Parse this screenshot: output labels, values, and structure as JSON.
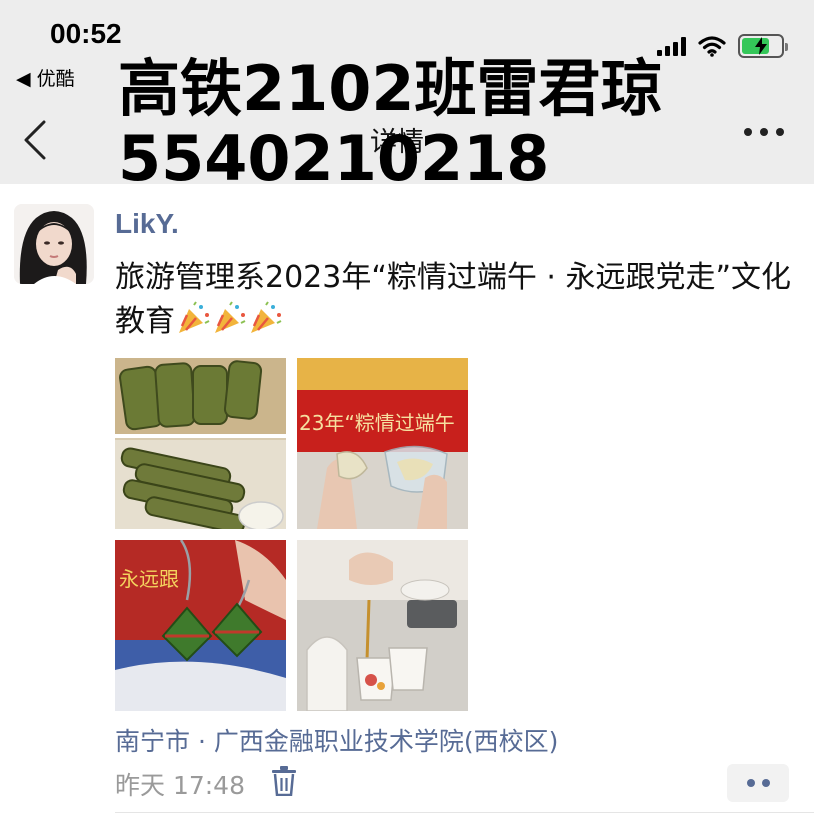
{
  "status_bar": {
    "time": "00:52",
    "back_app": "◀ 优酷"
  },
  "nav": {
    "title": "详情"
  },
  "overlay_text": {
    "line1": "高铁2102班雷君琼",
    "line2": "5540210218"
  },
  "post": {
    "username": "LikY.",
    "text": "旅游管理系2023年“粽情过端午 · 永远跟党走”文化教育",
    "emoji": [
      "party-popper",
      "party-popper",
      "party-popper"
    ],
    "location": "南宁市 · 广西金融职业技术学院(西校区)",
    "timestamp": "昨天 17:48"
  },
  "colors": {
    "nav_bg": "#ededed",
    "link": "#576b95",
    "meta_gray": "#9a9a9a",
    "battery_green": "#34c759"
  }
}
